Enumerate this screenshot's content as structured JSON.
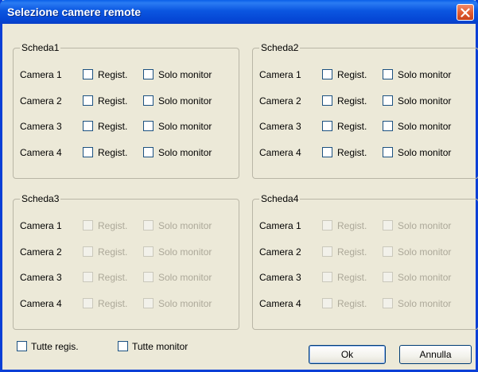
{
  "window": {
    "title": "Selezione camere remote"
  },
  "groups": [
    {
      "label": "Scheda1",
      "cameras": [
        {
          "label": "Camera 1",
          "regist": "Regist.",
          "monitor": "Solo monitor"
        },
        {
          "label": "Camera 2",
          "regist": "Regist.",
          "monitor": "Solo monitor"
        },
        {
          "label": "Camera 3",
          "regist": "Regist.",
          "monitor": "Solo monitor"
        },
        {
          "label": "Camera 4",
          "regist": "Regist.",
          "monitor": "Solo monitor"
        }
      ]
    },
    {
      "label": "Scheda2",
      "cameras": [
        {
          "label": "Camera 1",
          "regist": "Regist.",
          "monitor": "Solo monitor"
        },
        {
          "label": "Camera 2",
          "regist": "Regist.",
          "monitor": "Solo monitor"
        },
        {
          "label": "Camera 3",
          "regist": "Regist.",
          "monitor": "Solo monitor"
        },
        {
          "label": "Camera 4",
          "regist": "Regist.",
          "monitor": "Solo monitor"
        }
      ]
    },
    {
      "label": "Scheda3",
      "cameras": [
        {
          "label": "Camera 1",
          "regist": "Regist.",
          "monitor": "Solo monitor"
        },
        {
          "label": "Camera 2",
          "regist": "Regist.",
          "monitor": "Solo monitor"
        },
        {
          "label": "Camera 3",
          "regist": "Regist.",
          "monitor": "Solo monitor"
        },
        {
          "label": "Camera 4",
          "regist": "Regist.",
          "monitor": "Solo monitor"
        }
      ]
    },
    {
      "label": "Scheda4",
      "cameras": [
        {
          "label": "Camera 1",
          "regist": "Regist.",
          "monitor": "Solo monitor"
        },
        {
          "label": "Camera 2",
          "regist": "Regist.",
          "monitor": "Solo monitor"
        },
        {
          "label": "Camera 3",
          "regist": "Regist.",
          "monitor": "Solo monitor"
        },
        {
          "label": "Camera 4",
          "regist": "Regist.",
          "monitor": "Solo monitor"
        }
      ]
    }
  ],
  "bottom": {
    "all_regist": "Tutte regis.",
    "all_monitor": "Tutte monitor"
  },
  "buttons": {
    "ok": "Ok",
    "cancel": "Annulla"
  },
  "colors": {
    "titlebar": "#0b56e0",
    "dialog_bg": "#ece9d8",
    "close_button": "#e05a2f",
    "disabled_text": "#aca899"
  }
}
